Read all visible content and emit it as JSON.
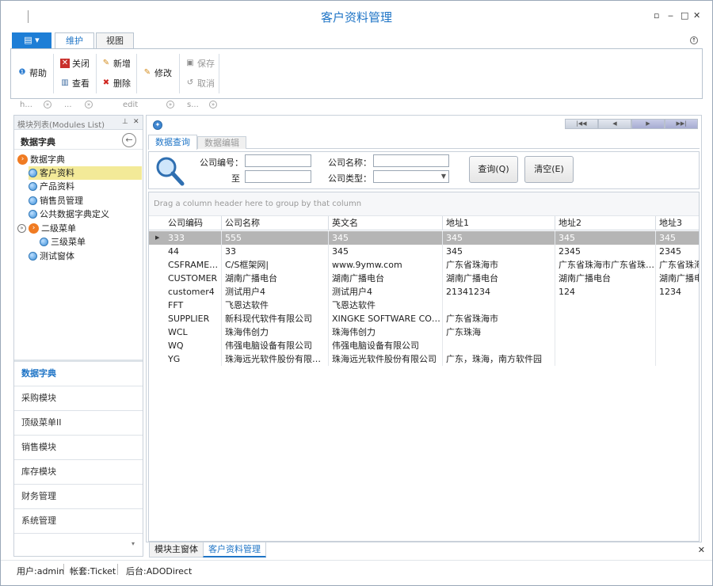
{
  "window": {
    "title": "客户资料管理",
    "controls": [
      "▫",
      "‒",
      "□",
      "✕"
    ]
  },
  "ribbon": {
    "app_button": "▤ ▾",
    "tabs": [
      {
        "label": "维护",
        "active": true
      },
      {
        "label": "视图",
        "active": false
      }
    ],
    "buttons": {
      "help": "帮助",
      "close": "关闭",
      "view": "查看",
      "new": "新增",
      "delete": "删除",
      "edit": "修改",
      "save": "保存",
      "cancel": "取消"
    },
    "groups": [
      "h...",
      "...",
      "edit",
      "s..."
    ]
  },
  "modules_panel": {
    "header": "模块列表(Modules List)",
    "pin": "▾ ✕",
    "title": "数据字典",
    "tree": [
      {
        "label": "数据字典",
        "icon": "orange-arrow-icon",
        "indent": 0
      },
      {
        "label": "客户资料",
        "icon": "blue-dot-icon",
        "indent": 1,
        "selected": true
      },
      {
        "label": "产品资料",
        "icon": "blue-dot-icon",
        "indent": 1
      },
      {
        "label": "销售员管理",
        "icon": "blue-dot-icon",
        "indent": 1
      },
      {
        "label": "公共数据字典定义",
        "icon": "blue-dot-icon",
        "indent": 1
      },
      {
        "label": "二级菜单",
        "icon": "orange-arrow-icon",
        "indent": 0
      },
      {
        "label": "三级菜单",
        "icon": "blue-dot-icon",
        "indent": 2
      },
      {
        "label": "测试窗体",
        "icon": "blue-dot-icon",
        "indent": 1
      }
    ],
    "nav": [
      {
        "label": "数据字典",
        "active": true
      },
      {
        "label": "采购模块"
      },
      {
        "label": "顶级菜单II"
      },
      {
        "label": "销售模块"
      },
      {
        "label": "库存模块"
      },
      {
        "label": "财务管理"
      },
      {
        "label": "系统管理"
      }
    ],
    "more": "▾"
  },
  "main": {
    "nav_buttons": [
      "|◀◀",
      "◀",
      "▶",
      "▶▶|"
    ],
    "subtabs": [
      {
        "label": "数据查询",
        "active": true
      },
      {
        "label": "数据编辑",
        "active": false
      }
    ],
    "query": {
      "company_code_label": "公司编号：",
      "to_label": "至",
      "company_name_label": "公司名称：",
      "company_type_label": "公司类型：",
      "query_button": "查询(Q)",
      "clear_button": "清空(E)"
    },
    "grid": {
      "group_hint": "Drag a column header here to group by that column",
      "columns": [
        "公司编码",
        "公司名称",
        "英文名",
        "地址1",
        "地址2",
        "地址3"
      ],
      "rows": [
        [
          "333",
          "555",
          "345",
          "345",
          "345",
          "345"
        ],
        [
          "44",
          "33",
          "345",
          "345",
          "2345",
          "2345"
        ],
        [
          "CSFRAMEW…",
          "C/S框架网|",
          "www.9ymw.com",
          "广东省珠海市",
          "广东省珠海市广东省珠海市",
          "广东省珠海"
        ],
        [
          "CUSTOMER",
          "湖南广播电台",
          "湖南广播电台",
          "湖南广播电台",
          "湖南广播电台",
          "湖南广播电"
        ],
        [
          "customer4",
          "测试用户4",
          "测试用户4",
          "21341234",
          "124",
          "1234"
        ],
        [
          "FFT",
          "飞恩达软件",
          "飞恩达软件",
          "",
          "",
          ""
        ],
        [
          "SUPPLIER",
          "新科现代软件有限公司",
          "XINGKE SOFTWARE COMP…",
          "广东省珠海市",
          "",
          ""
        ],
        [
          "WCL",
          "珠海伟创力",
          "珠海伟创力",
          "广东珠海",
          "",
          ""
        ],
        [
          "WQ",
          "伟强电脑设备有限公司",
          "伟强电脑设备有限公司",
          "",
          "",
          ""
        ],
        [
          "YG",
          "珠海远光软件股份有限公司",
          "珠海远光软件股份有限公司",
          "广东，珠海，南方软件园",
          "",
          ""
        ]
      ],
      "focused_row": 0
    }
  },
  "doc_tabs": [
    {
      "label": "模块主窗体",
      "active": false
    },
    {
      "label": "客户资料管理",
      "active": true
    }
  ],
  "doc_close": "✕",
  "status": {
    "user": "用户:admin",
    "account": "帐套:Ticket",
    "backend": "后台:ADODirect"
  }
}
